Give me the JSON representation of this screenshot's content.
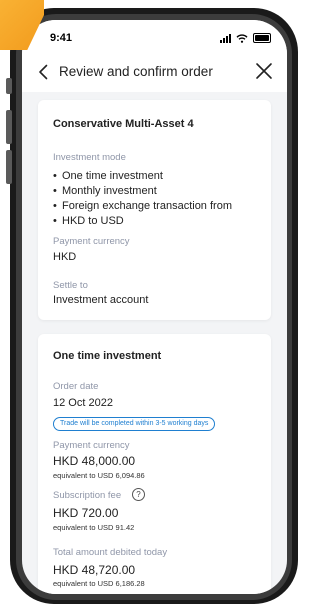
{
  "status_bar": {
    "time": "9:41"
  },
  "header": {
    "title": "Review and confirm order"
  },
  "summary_card": {
    "title": "Conservative Multi-Asset 4",
    "investment_mode_label": "Investment mode",
    "investment_modes": [
      "One time investment",
      "Monthly investment",
      "Foreign exchange transaction from",
      "HKD to USD"
    ],
    "payment_currency_label": "Payment currency",
    "payment_currency_value": "HKD",
    "settle_to_label": "Settle to",
    "settle_to_value": "Investment account"
  },
  "one_time_card": {
    "title": "One time investment",
    "order_date_label": "Order date",
    "order_date_value": "12 Oct 2022",
    "notice_pill": "Trade will be completed within 3-5 working days",
    "payment_currency_label": "Payment currency",
    "payment_amount": "HKD 48,000.00",
    "payment_equivalent": "equivalent to USD 6,094.86",
    "subscription_fee_label": "Subscription fee",
    "help_symbol": "?",
    "subscription_fee_value": "HKD 720.00",
    "subscription_fee_equivalent": "equivalent to USD 91.42",
    "total_debited_label": "Total amount debited today",
    "total_debited_value": "HKD 48,720.00",
    "total_debited_equivalent": "equivalent to USD 6,186.28"
  },
  "colors": {
    "accent_orange": "#f29b1d",
    "link_blue": "#1f7fd0",
    "label_grey": "#8f96a8"
  },
  "icons": [
    "back-arrow-icon",
    "close-icon",
    "help-icon",
    "signal-icon",
    "wifi-icon",
    "battery-icon"
  ]
}
